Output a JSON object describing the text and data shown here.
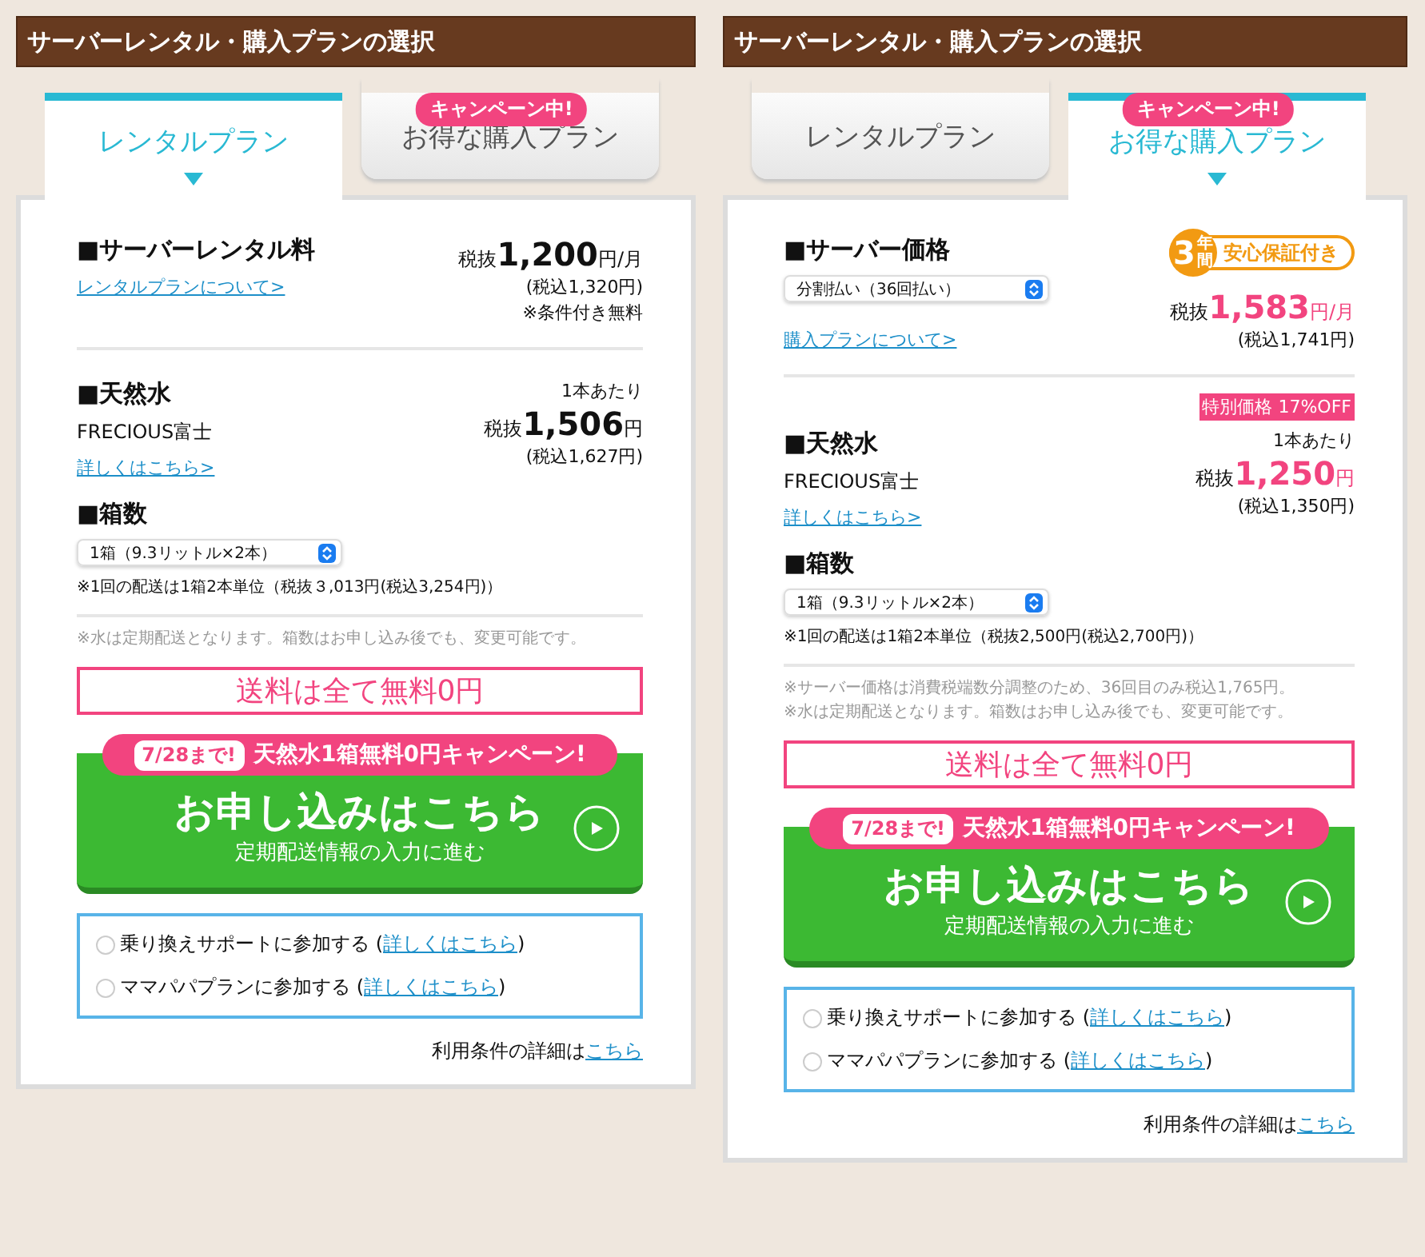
{
  "panels": [
    {
      "title": "サーバーレンタル・購入プランの選択",
      "tabs": [
        {
          "label": "レンタルプラン",
          "selected": true
        },
        {
          "label": "お得な購入プラン",
          "selected": false,
          "badge": "キャンペーン中!"
        }
      ],
      "sections": [
        {
          "kind": "price",
          "heading": "■サーバーレンタル料",
          "link": "レンタルプランについて>",
          "price": {
            "prefix": "税抜",
            "amount": "1,200",
            "unit": "円/月",
            "highlight": false
          },
          "tax": "(税込1,320円)",
          "note": "※条件付き無料"
        },
        {
          "kind": "water",
          "heading": "■天然水",
          "name": "FRECIOUS富士",
          "link": "詳しくはこちら>",
          "per": "1本あたり",
          "price": {
            "prefix": "税抜",
            "amount": "1,506",
            "unit": "円",
            "highlight": false
          },
          "tax": "(税込1,627円)"
        },
        {
          "kind": "boxes",
          "heading": "■箱数",
          "select": "1箱（9.3リットル×2本）",
          "note": "※1回の配送は1箱2本単位（税抜３,013円(税込3,254円)）"
        }
      ],
      "notes": [
        "※水は定期配送となります。箱数はお申し込み後でも、変更可能です。"
      ],
      "shipping": "送料は全て無料0円",
      "cta": {
        "date": "7/28まで!",
        "campaign": "天然水1箱無料0円キャンペーン!",
        "title": "お申し込みはこちら",
        "subtitle": "定期配送情報の入力に進む"
      },
      "options": [
        {
          "label": "乗り換えサポートに参加する (",
          "link": "詳しくはこちら",
          "suffix": ")",
          "checked": false
        },
        {
          "label": "ママパパプランに参加する (",
          "link": "詳しくはこちら",
          "suffix": ")",
          "checked": false
        }
      ],
      "terms": {
        "text": "利用条件の詳細は",
        "link": "こちら"
      }
    },
    {
      "title": "サーバーレンタル・購入プランの選択",
      "tabs": [
        {
          "label": "レンタルプラン",
          "selected": false
        },
        {
          "label": "お得な購入プラン",
          "selected": true,
          "badge": "キャンペーン中!"
        }
      ],
      "sections": [
        {
          "kind": "price",
          "heading": "■サーバー価格",
          "select": "分割払い（36回払い）",
          "link": "購入プランについて>",
          "guarantee": {
            "number": "3",
            "unit": "年間",
            "text": "安心保証付き"
          },
          "price": {
            "prefix": "税抜",
            "amount": "1,583",
            "unit": "円/月",
            "highlight": true
          },
          "tax": "(税込1,741円)"
        },
        {
          "kind": "water",
          "heading": "■天然水",
          "name": "FRECIOUS富士",
          "link": "詳しくはこちら>",
          "tag": "特別価格 17%OFF",
          "per": "1本あたり",
          "price": {
            "prefix": "税抜",
            "amount": "1,250",
            "unit": "円",
            "highlight": true
          },
          "tax": "(税込1,350円)"
        },
        {
          "kind": "boxes",
          "heading": "■箱数",
          "select": "1箱（9.3リットル×2本）",
          "note": "※1回の配送は1箱2本単位（税抜2,500円(税込2,700円)）"
        }
      ],
      "notes": [
        "※サーバー価格は消費税端数分調整のため、36回目のみ税込1,765円。",
        "※水は定期配送となります。箱数はお申し込み後でも、変更可能です。"
      ],
      "shipping": "送料は全て無料0円",
      "cta": {
        "date": "7/28まで!",
        "campaign": "天然水1箱無料0円キャンペーン!",
        "title": "お申し込みはこちら",
        "subtitle": "定期配送情報の入力に進む"
      },
      "options": [
        {
          "label": "乗り換えサポートに参加する (",
          "link": "詳しくはこちら",
          "suffix": ")",
          "checked": false
        },
        {
          "label": "ママパパプランに参加する (",
          "link": "詳しくはこちら",
          "suffix": ")",
          "checked": false
        }
      ],
      "terms": {
        "text": "利用条件の詳細は",
        "link": "こちら"
      }
    }
  ]
}
